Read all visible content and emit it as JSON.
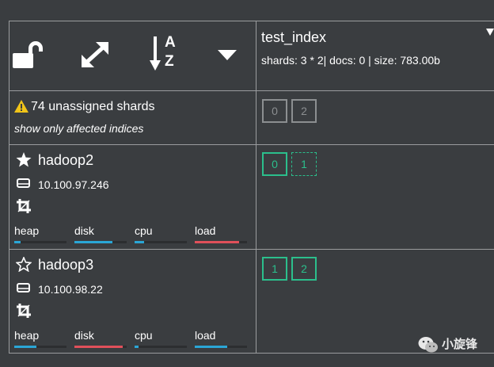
{
  "toolbar": {
    "lock_icon": "unlock-icon",
    "expand_icon": "expand-icon",
    "sort_icon": "sort-alpha-icon",
    "sort_letter_a": "A",
    "sort_letter_z": "Z",
    "dropdown_icon": "caret-down-icon"
  },
  "index": {
    "name": "test_index",
    "meta": "shards: 3 * 2| docs: 0 | size: 783.00b"
  },
  "unassigned": {
    "warning": "74 unassigned shards",
    "filter_link": "show only affected indices",
    "shards": [
      "0",
      "2"
    ]
  },
  "nodes": [
    {
      "name": "hadoop2",
      "ip": "10.100.97.246",
      "master": true,
      "metrics": [
        {
          "label": "heap",
          "value": 0.12,
          "color": "#2aa6d6"
        },
        {
          "label": "disk",
          "value": 0.72,
          "color": "#2aa6d6"
        },
        {
          "label": "cpu",
          "value": 0.18,
          "color": "#2aa6d6"
        },
        {
          "label": "load",
          "value": 0.85,
          "color": "#e0505a"
        }
      ],
      "shards": [
        {
          "label": "0",
          "state": "started"
        },
        {
          "label": "1",
          "state": "initializing"
        }
      ]
    },
    {
      "name": "hadoop3",
      "ip": "10.100.98.22",
      "master": false,
      "metrics": [
        {
          "label": "heap",
          "value": 0.42,
          "color": "#2aa6d6"
        },
        {
          "label": "disk",
          "value": 0.92,
          "color": "#e0505a"
        },
        {
          "label": "cpu",
          "value": 0.08,
          "color": "#2aa6d6"
        },
        {
          "label": "load",
          "value": 0.62,
          "color": "#2aa6d6"
        }
      ],
      "shards": [
        {
          "label": "1",
          "state": "started"
        },
        {
          "label": "2",
          "state": "started"
        }
      ]
    }
  ],
  "watermark": {
    "text": "小旋锋"
  },
  "colors": {
    "background": "#3a3d40",
    "grid_line": "#9a9c9e",
    "shard_started": "#2bbf8c",
    "shard_unassigned": "#8c8f91",
    "warning": "#f0c419"
  }
}
